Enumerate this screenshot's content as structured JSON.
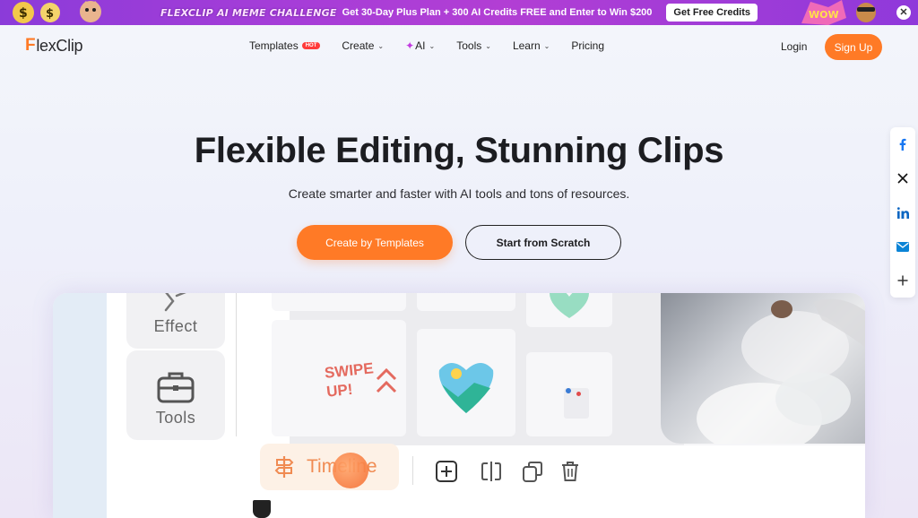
{
  "promo": {
    "title": "FLEXCLIP AI MEME CHALLENGE",
    "text": "Get 30-Day Plus Plan + 300 AI Credits FREE and Enter to Win $200",
    "cta": "Get Free Credits",
    "close": "✕"
  },
  "nav": {
    "logo_f": "F",
    "logo_rest": "lexClip",
    "items": [
      {
        "label": "Templates",
        "badge": "HOT"
      },
      {
        "label": "Create",
        "chevron": "⌄"
      },
      {
        "label": "AI",
        "prefix": "✦",
        "chevron": "⌄"
      },
      {
        "label": "Tools",
        "chevron": "⌄"
      },
      {
        "label": "Learn",
        "chevron": "⌄"
      },
      {
        "label": "Pricing"
      }
    ],
    "login": "Login",
    "signup": "Sign Up"
  },
  "hero": {
    "title": "Flexible Editing, Stunning Clips",
    "subtitle": "Create smarter and faster with AI tools and tons of resources.",
    "primary_cta": "Create by Templates",
    "secondary_cta": "Start from Scratch"
  },
  "share": {
    "items": [
      "facebook-icon",
      "x-icon",
      "linkedin-icon",
      "email-icon",
      "plus-icon"
    ]
  },
  "preview": {
    "effect_label": "Effect",
    "tools_label": "Tools",
    "timeline_label": "Timeline",
    "sticker_text_1": "SWIPE",
    "sticker_text_2": "UP!"
  },
  "colors": {
    "accent": "#ff7a26",
    "promo_bg": "#a53dd8",
    "text_dark": "#1c1d21"
  }
}
